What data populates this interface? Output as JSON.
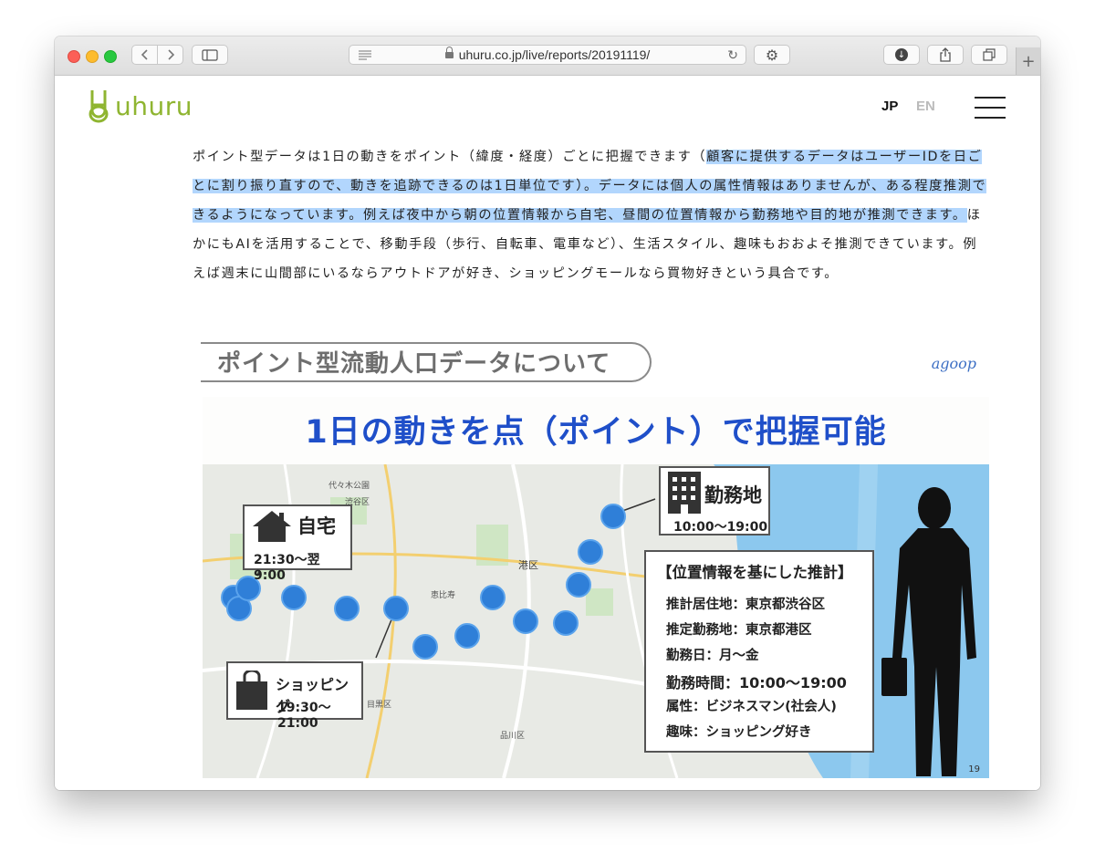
{
  "browser": {
    "url": "uhuru.co.jp/live/reports/20191119/",
    "back_icon": "chevron-left-icon",
    "forward_icon": "chevron-right-icon"
  },
  "site": {
    "logo_text": "uhuru",
    "lang_jp": "JP",
    "lang_en": "EN"
  },
  "article": {
    "text_before_selection": "ポイント型データは1日の動きをポイント（緯度・経度）ごとに把握できます（",
    "selected_text": "顧客に提供するデータはユーザーIDを日ごとに割り振り直すので、動きを追跡できるのは1日単位です）。データには個人の属性情報はありませんが、ある程度推測できるようになっています。例えば夜中から朝の位置情報から自宅、昼間の位置情報から勤務地や目的地が推測できます。",
    "text_after_selection": "ほかにもAIを活用することで、移動手段（歩行、自転車、電車など）、生活スタイル、趣味もおおよそ推測できています。例えば週末に山間部にいるならアウトドアが好き、ショッピングモールなら買物好きという具合です。"
  },
  "figure": {
    "title": "ポイント型流動人口データについて",
    "brand": "agoop",
    "banner": "1日の動きを点（ポイント）で把握可能",
    "home_label": "自宅",
    "home_time": "21:30〜翌9:00",
    "work_label": "勤務地",
    "work_time": "10:00〜19:00",
    "shop_label": "ショッピング",
    "shop_time": "19:30〜21:00",
    "info_title": "【位置情報を基にした推計】",
    "info_rows": [
      "推計居住地：東京都渋谷区",
      "推定勤務地：東京都港区",
      "勤務日：月〜金",
      "勤務時間：10:00〜19:00",
      "属性：ビジネスマン(社会人)",
      "趣味：ショッピング好き"
    ],
    "map_labels": [
      "代々木公園",
      "渋谷区",
      "港区",
      "品川区",
      "目黒区",
      "恵比寿"
    ],
    "slide_number": "19",
    "point_color": "#2f7fd8"
  }
}
